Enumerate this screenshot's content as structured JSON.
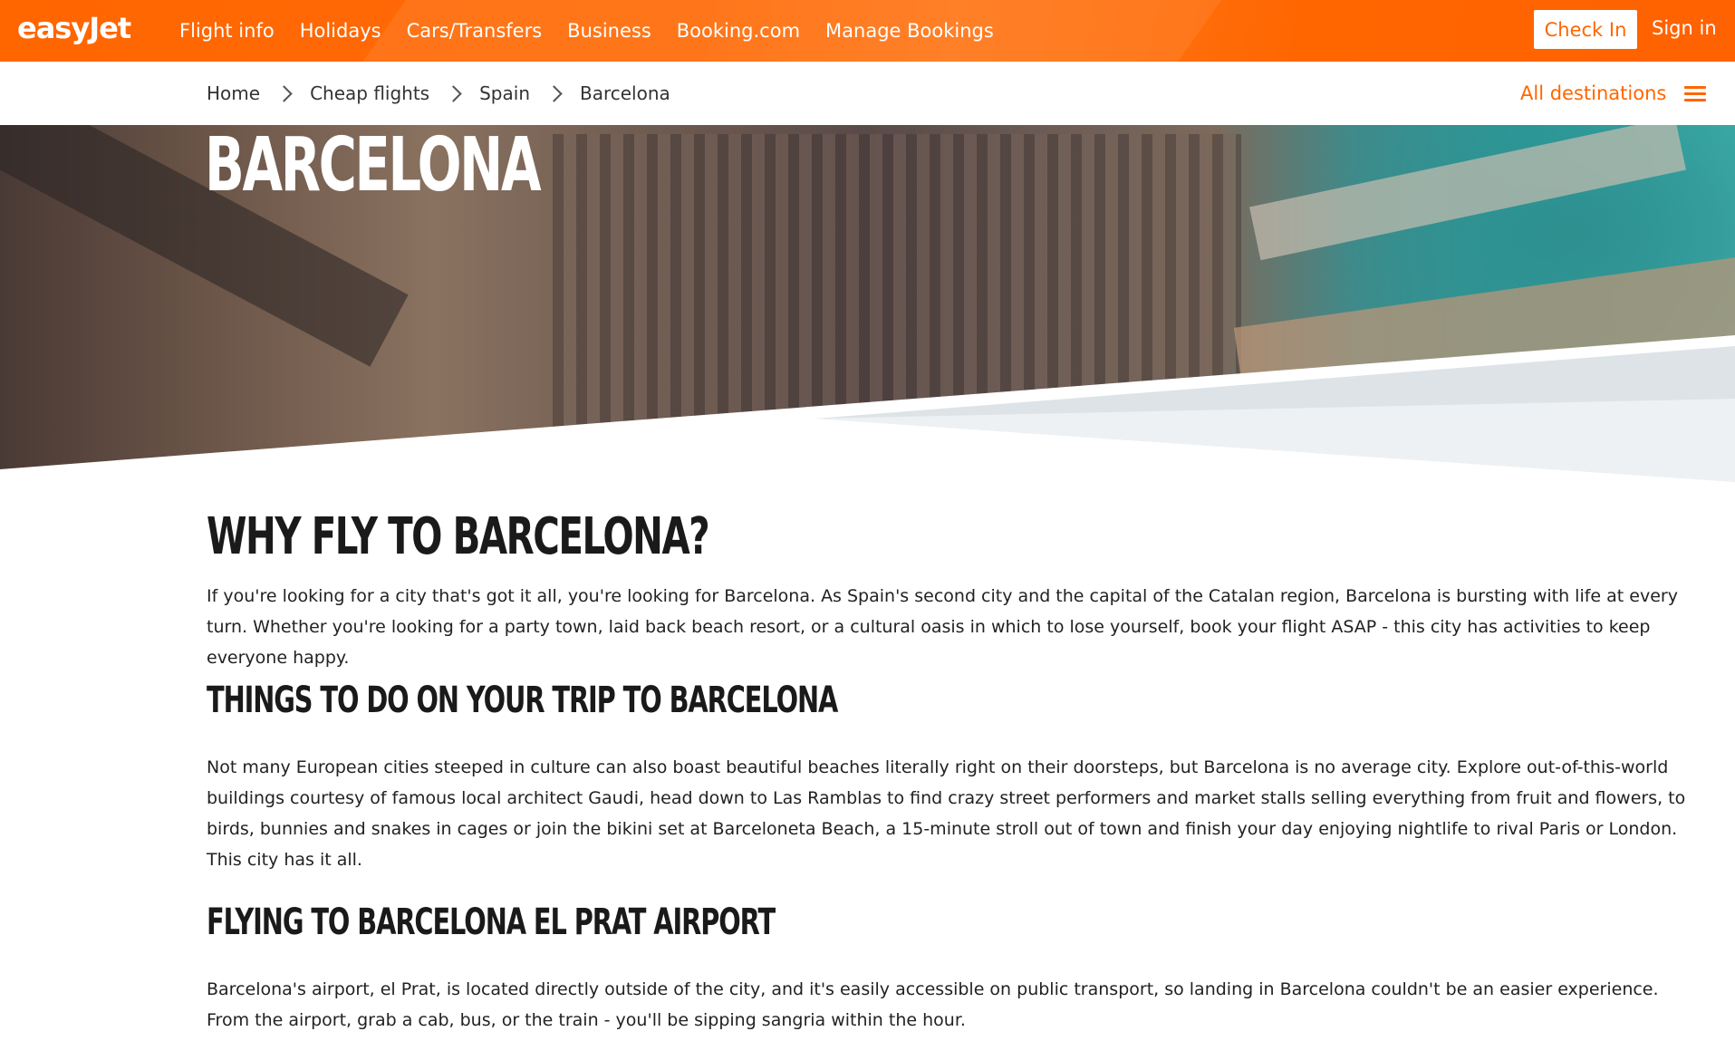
{
  "header": {
    "logo_text": "easyJet",
    "nav_items": [
      {
        "label": "Flight info"
      },
      {
        "label": "Holidays"
      },
      {
        "label": "Cars/Transfers"
      },
      {
        "label": "Business"
      },
      {
        "label": "Booking.com"
      },
      {
        "label": "Manage Bookings"
      }
    ],
    "check_in_label": "Check In",
    "sign_in_label": "Sign in",
    "brand_color": "#ff6600"
  },
  "breadcrumb": {
    "items": [
      {
        "label": "Home"
      },
      {
        "label": "Cheap flights"
      },
      {
        "label": "Spain"
      },
      {
        "label": "Barcelona"
      }
    ],
    "all_destinations_label": "All destinations"
  },
  "hero": {
    "title": "BARCELONA"
  },
  "content": {
    "why_title": "WHY FLY TO BARCELONA?",
    "why_text": "If you're looking for a city that's got it all, you're looking for Barcelona. As Spain's second city and the capital of the Catalan region, Barcelona is bursting with life at every turn. Whether you're looking for a party town, laid back beach resort, or a cultural oasis in which to lose yourself, book your flight ASAP - this city has activities to keep everyone happy.",
    "things_title": "THINGS TO DO ON YOUR TRIP TO BARCELONA",
    "things_text": "Not many European cities steeped in culture can also boast beautiful beaches literally right on their doorsteps, but Barcelona is no average city. Explore out-of-this-world buildings courtesy of famous local architect Gaudi, head down to Las Ramblas to find crazy street performers and market stalls selling everything from fruit and flowers, to birds, bunnies and snakes in cages or join the bikini set at Barceloneta Beach, a 15-minute stroll out of town and finish your day enjoying nightlife to rival Paris or London. This city has it all.",
    "airport_title": "FLYING TO BARCELONA EL PRAT AIRPORT",
    "airport_text": "Barcelona's airport, el Prat, is located directly outside of the city, and it's easily accessible on public transport, so landing in Barcelona couldn't be an easier experience. From the airport, grab a cab, bus, or the train - you'll be sipping sangria within the hour."
  }
}
